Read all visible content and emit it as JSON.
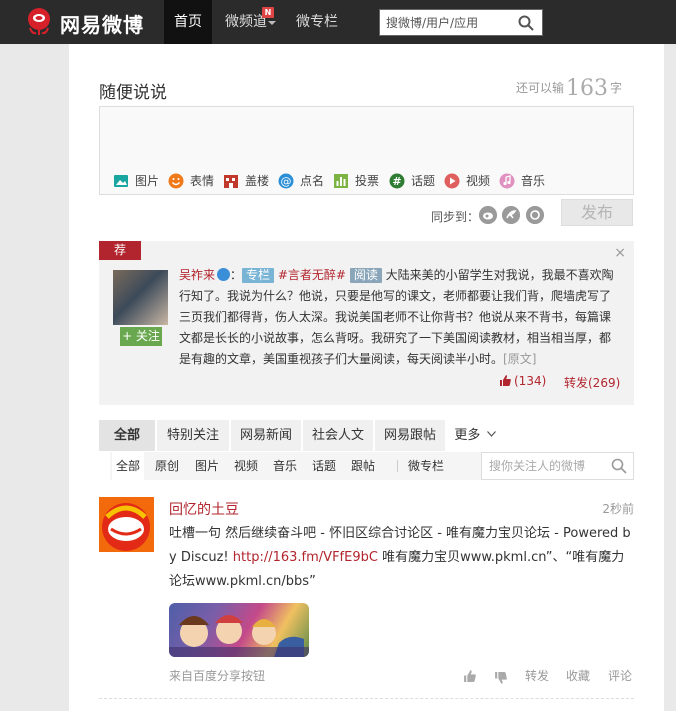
{
  "header": {
    "logo_text": "网易微博",
    "nav": [
      {
        "label": "首页",
        "active": true
      },
      {
        "label": "微频道",
        "active": false,
        "badge": "N"
      },
      {
        "label": "微专栏",
        "active": false
      }
    ],
    "search_placeholder": "搜微博/用户/应用"
  },
  "composer": {
    "title": "随便说说",
    "remaining_prefix": "还可以输",
    "remaining_count": "163",
    "remaining_suffix": "字",
    "tools": [
      {
        "label": "图片",
        "icon": "image-icon",
        "color": "#1aa6a0"
      },
      {
        "label": "表情",
        "icon": "emoji-icon",
        "color": "#f07a1a"
      },
      {
        "label": "盖楼",
        "icon": "building-icon",
        "color": "#c0392b"
      },
      {
        "label": "点名",
        "icon": "at-icon",
        "color": "#2b8fd6"
      },
      {
        "label": "投票",
        "icon": "vote-icon",
        "color": "#7cb342"
      },
      {
        "label": "话题",
        "icon": "hashtag-icon",
        "color": "#2e7d32"
      },
      {
        "label": "视频",
        "icon": "video-icon",
        "color": "#e06060"
      },
      {
        "label": "音乐",
        "icon": "music-icon",
        "color": "#e091c0"
      }
    ],
    "sync_label": "同步到：",
    "publish_label": "发布"
  },
  "recommend": {
    "tag": "荐",
    "close": "×",
    "follow_label": "+ 关注",
    "author": "吴祚来",
    "colon": "：",
    "chip_column": "专栏",
    "topic": "#言者无醉#",
    "chip_read": "阅读",
    "text": "大陆来美的小留学生对我说，我最不喜欢陶行知了。我说为什么？他说，只要是他写的课文，老师都要让我们背，爬墙虎写了三页我们都得背，伤人太深。我说美国老师不让你背书？他说从来不背书，每篇课文都是长长的小说故事，怎么背呀。我研究了一下美国阅读教材，相当相当厚，都是有趣的文章，美国重视孩子们大量阅读，每天阅读半小时。",
    "original_label": "[原文]",
    "likes": "(134)",
    "forward": "转发(269)"
  },
  "filters": {
    "tabs": [
      "全部",
      "特别关注",
      "网易新闻",
      "社会人文",
      "网易跟帖",
      "更多"
    ],
    "sub": [
      "全部",
      "原创",
      "图片",
      "视频",
      "音乐",
      "话题",
      "跟帖",
      "微专栏"
    ],
    "sub_search_placeholder": "搜你关注人的微博"
  },
  "feed": {
    "name": "回忆的土豆",
    "time": "2秒前",
    "text_before": "吐槽一句 然后继续奋斗吧 - 怀旧区综合讨论区 - 唯有魔力宝贝论坛 - Powered by Discuz! ",
    "link": "http://163.fm/VFfE9bC",
    "text_after": " 唯有魔力宝贝www.pkml.cn”、“唯有魔力论坛www.pkml.cn/bbs”",
    "source": "来自百度分享按钮",
    "actions": [
      "转发",
      "收藏",
      "评论"
    ]
  },
  "colors": {
    "brand_red": "#b2252e",
    "topbar": "#2b2b2b"
  }
}
